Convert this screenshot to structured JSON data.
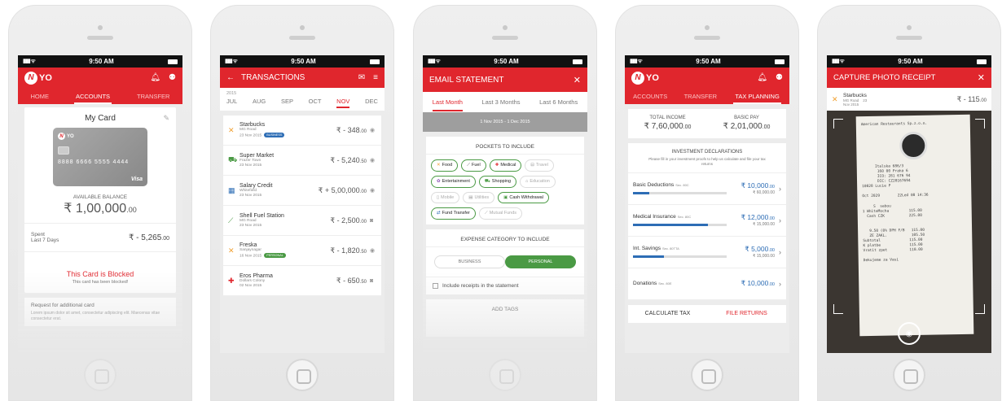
{
  "status": {
    "time": "9:50 AM"
  },
  "brand": "YO",
  "screen1": {
    "tabs": [
      "HOME",
      "ACCOUNTS",
      "TRANSFER"
    ],
    "card_title": "My Card",
    "card_number": "8888  6666  5555  4444",
    "card_brand": "Visa",
    "avail_label": "AVAILABLE BALANCE",
    "avail_main": "₹ 1,00,000",
    "avail_dec": ".00",
    "spent_label": "Spent",
    "spent_period": "Last 7 Days",
    "spent_main": "₹ - 5,265",
    "spent_dec": ".00",
    "blocked_title": "This Card is Blocked",
    "blocked_sub": "This card has been blocked!",
    "request_title": "Request for additional card",
    "request_desc": "Lorem ipsum dolor sit amet, consectetur adipiscing elit. Maecenas vitae consectetur erat."
  },
  "screen2": {
    "title": "TRANSACTIONS",
    "year": "2015",
    "months": [
      "JUL",
      "AUG",
      "SEP",
      "OCT",
      "NOV",
      "DEC"
    ],
    "items": [
      {
        "name": "Starbucks",
        "l1": "MG Road",
        "l2": "23 Nov 2015",
        "tag": "BUSINESS",
        "amt": "₹ - 348",
        "dec": ".00",
        "icon": "✕",
        "color": "#f0a030"
      },
      {
        "name": "Super Market",
        "l1": "Frazer Town",
        "l2": "23 Nov 2015",
        "tag": "",
        "amt": "₹ - 5,240",
        "dec": ".50",
        "icon": "⛟",
        "color": "#4a9a44"
      },
      {
        "name": "Salary Credit",
        "l1": "Whitefield",
        "l2": "23 Nov 2015",
        "tag": "",
        "amt": "₹ + 5,00,000",
        "dec": ".00",
        "icon": "▦",
        "color": "#2d6db5"
      },
      {
        "name": "Shell Fuel Station",
        "l1": "MG Road",
        "l2": "23 Nov 2015",
        "tag": "",
        "amt": "₹ - 2,500",
        "dec": ".00",
        "icon": "⟋",
        "color": "#4a9a44"
      },
      {
        "name": "Freska",
        "l1": "Sanjaynagar",
        "l2": "16 Nov 2015",
        "tag": "PERSONAL",
        "amt": "₹ - 1,820",
        "dec": ".50",
        "icon": "✕",
        "color": "#f0a030"
      },
      {
        "name": "Eros Pharma",
        "l1": "Dollars Colony",
        "l2": "02 Nov 2015",
        "tag": "",
        "amt": "₹ - 650",
        "dec": ".50",
        "icon": "✚",
        "color": "#e0262d"
      }
    ]
  },
  "screen3": {
    "title": "EMAIL STATEMENT",
    "subtabs": [
      "Last Month",
      "Last 3 Months",
      "Last 6 Months"
    ],
    "range": "1 Nov 2015 - 1 Dec 2015",
    "pockets_head": "POCKETS TO INCLUDE",
    "pockets": [
      {
        "label": "Food",
        "sel": true
      },
      {
        "label": "Fuel",
        "sel": true
      },
      {
        "label": "Medical",
        "sel": true
      },
      {
        "label": "Travel",
        "sel": false
      },
      {
        "label": "Entertainment",
        "sel": true
      },
      {
        "label": "Shopping",
        "sel": true
      },
      {
        "label": "Education",
        "sel": false
      },
      {
        "label": "Mobile",
        "sel": false
      },
      {
        "label": "Utilities",
        "sel": false
      },
      {
        "label": "Cash Withdrawal",
        "sel": true
      },
      {
        "label": "Fund Transfer",
        "sel": true
      },
      {
        "label": "Mutual Funds",
        "sel": false
      }
    ],
    "expense_head": "EXPENSE CATEGORY TO INCLUDE",
    "expense_opts": [
      "BUSINESS",
      "PERSONAL"
    ],
    "include_receipts": "Include receipts in the statement",
    "add_tags": "ADD TAGS"
  },
  "screen4": {
    "tabs": [
      "ACCOUNTS",
      "TRANSFER",
      "TAX PLANNING"
    ],
    "income_label": "TOTAL INCOME",
    "income_main": "₹ 7,60,000",
    "income_dec": ".00",
    "basic_label": "BASIC PAY",
    "basic_main": "₹ 2,01,000",
    "basic_dec": ".00",
    "decl_head": "INVESTMENT DECLARATIONS",
    "decl_sub": "Please fill in your investment proofs to help us calculate and file your tax returns",
    "rows": [
      {
        "name": "Basic Deductions",
        "sec": "Sec. 80C",
        "v1": "₹ 10,000",
        "d1": ".00",
        "v2": "₹ 60,000.00",
        "fill": 0.17
      },
      {
        "name": "Medical Insurance",
        "sec": "Sec. 80C",
        "v1": "₹ 12,000",
        "d1": ".00",
        "v2": "₹ 15,000.00",
        "fill": 0.8
      },
      {
        "name": "Int. Savings",
        "sec": "Sec. 80TTA",
        "v1": "₹ 5,000",
        "d1": ".00",
        "v2": "₹ 15,000.00",
        "fill": 0.33
      },
      {
        "name": "Donations",
        "sec": "Sec. 80E",
        "v1": "₹ 10,000",
        "d1": ".00",
        "v2": "",
        "fill": null
      }
    ],
    "calc": "CALCULATE TAX",
    "file": "FILE RETURNS"
  },
  "screen5": {
    "title": "CAPTURE PHOTO RECEIPT",
    "name": "Starbucks",
    "l1": "MG Road",
    "l2": "Nov 2015",
    "count": "23",
    "amt": "₹ - 115",
    "dec": ".00",
    "receipt_lines": "American Restaurants Sp.z.o.o.\n\n\n\n      Italska 686/3\n       160 00 Praha 6\n       ICO: 281 676 94\n       DIC: CZ28167694\n10028 Lucie P\n\nOct 2029        22Led 08 14:36\n\n     S  sebou\n1 WhiteMocha         115.00\n  Cash CZK           225.00\n\n\n   9.50 (0% DPH F/B   115.00\n   ZE ZAKL.           105.50\nSubtotal             115.00\nK platbe             115.00\nVratit zpet          110.00\n\nDekujeme za Vasi"
  }
}
